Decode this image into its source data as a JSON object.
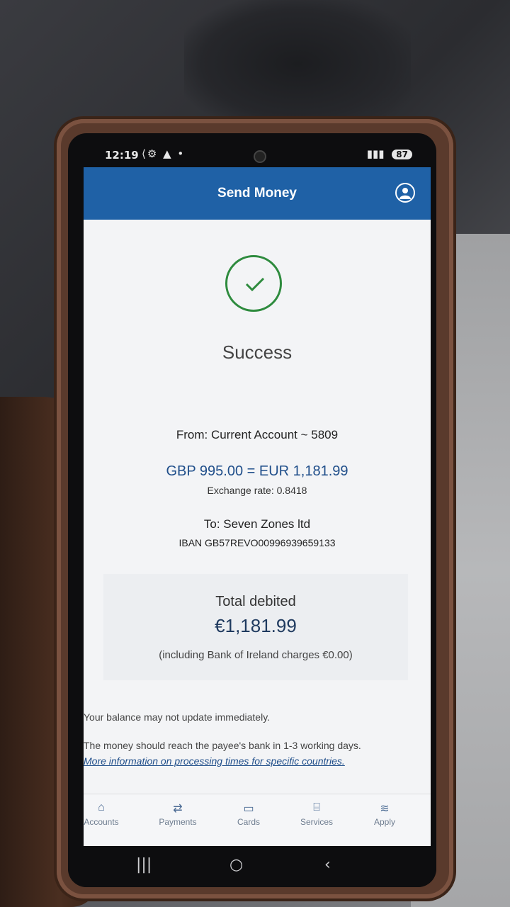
{
  "status_bar": {
    "time": "12:19",
    "left_icons": "⟨⚙ ▲ •",
    "battery": "87"
  },
  "header": {
    "title": "Send Money"
  },
  "result": {
    "status": "Success",
    "from": "From: Current Account ~ 5809",
    "amount_line": "GBP 995.00 = EUR 1,181.99",
    "exchange_rate": "Exchange rate: 0.8418",
    "to": "To: Seven Zones ltd",
    "iban": "IBAN GB57REVO00996939659133"
  },
  "total": {
    "label": "Total debited",
    "amount": "€1,181.99",
    "note": "(including Bank of Ireland charges €0.00)"
  },
  "notes": {
    "balance": "Your balance may not update immediately.",
    "reach": "The money should reach the payee's bank in 1-3 working days.",
    "more_link": "More information on processing times for specific countries."
  },
  "nav": {
    "items": [
      {
        "label": "Accounts",
        "icon": "home-icon"
      },
      {
        "label": "Payments",
        "icon": "transfer-icon"
      },
      {
        "label": "Cards",
        "icon": "card-icon"
      },
      {
        "label": "Services",
        "icon": "bank-icon"
      },
      {
        "label": "Apply",
        "icon": "apply-icon"
      }
    ]
  },
  "colors": {
    "header": "#1f61a6",
    "success": "#2e8b3e",
    "link": "#1f4e8a"
  }
}
